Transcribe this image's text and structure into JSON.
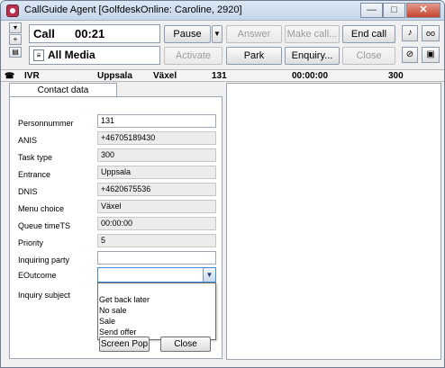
{
  "window": {
    "title": "CallGuide Agent [GolfdeskOnline: Caroline, 2920]",
    "minimize": "—",
    "maximize": "□",
    "close": "✕"
  },
  "call": {
    "label": "Call",
    "timer": "00:21"
  },
  "media": {
    "label": "All Media"
  },
  "buttons": {
    "pause": "Pause",
    "answer": "Answer",
    "make_call": "Make call...",
    "end_call": "End call",
    "activate": "Activate",
    "park": "Park",
    "enquiry": "Enquiry...",
    "close": "Close"
  },
  "status": {
    "channel": "IVR",
    "location": "Uppsala",
    "queue": "Växel",
    "code": "131",
    "time": "00:00:00",
    "count": "300"
  },
  "tab": {
    "label": "Contact data"
  },
  "fields": [
    {
      "label": "Personnummer",
      "value": "131"
    },
    {
      "label": "ANIS",
      "value": "+46705189430"
    },
    {
      "label": "Task type",
      "value": "300"
    },
    {
      "label": "Entrance",
      "value": "Uppsala"
    },
    {
      "label": "DNIS",
      "value": "+4620675536"
    },
    {
      "label": "Menu choice",
      "value": "Växel"
    },
    {
      "label": "Queue timeTS",
      "value": "00:00:00"
    },
    {
      "label": "Priority",
      "value": "5"
    },
    {
      "label": "Inquiring party",
      "value": ""
    },
    {
      "label": "EOutcome",
      "value": ""
    },
    {
      "label": "Inquiry subject",
      "value": ""
    }
  ],
  "outcome_options": [
    "",
    "Get back later",
    "No sale",
    "Sale",
    "Send offer"
  ],
  "bottom_buttons": {
    "screen_pop": "Screen Pop",
    "close": "Close"
  },
  "colors": {
    "accent": "#3a8fd8",
    "brand": "#b7304f"
  }
}
